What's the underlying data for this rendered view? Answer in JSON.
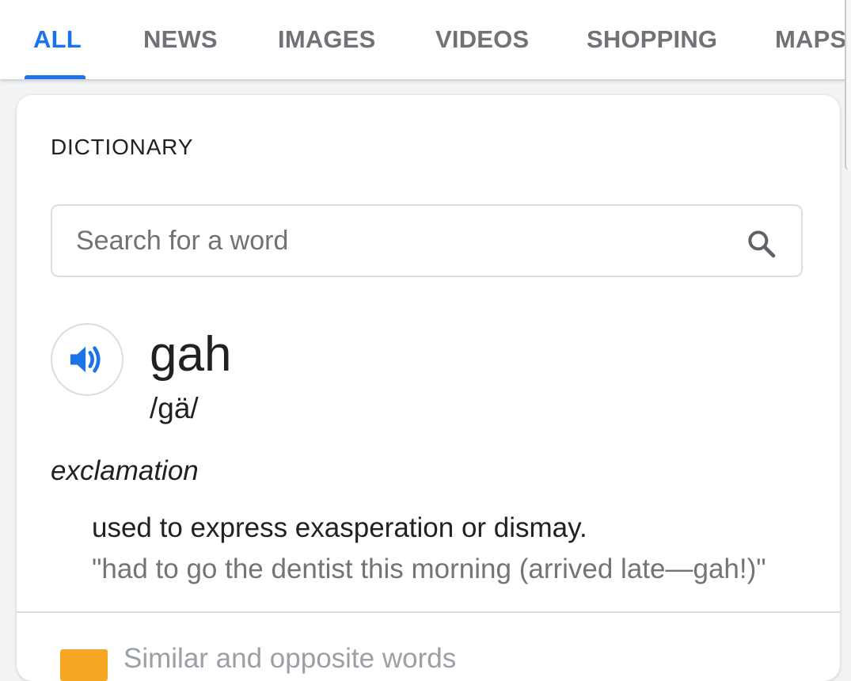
{
  "tabs": [
    {
      "label": "ALL",
      "active": true
    },
    {
      "label": "NEWS",
      "active": false
    },
    {
      "label": "IMAGES",
      "active": false
    },
    {
      "label": "VIDEOS",
      "active": false
    },
    {
      "label": "SHOPPING",
      "active": false
    },
    {
      "label": "MAPS",
      "active": false
    }
  ],
  "dictionary": {
    "title": "DICTIONARY",
    "search": {
      "placeholder": "Search for a word",
      "value": "",
      "icon": "search-icon"
    },
    "entry": {
      "pronounce_icon": "speaker-icon",
      "word": "gah",
      "phonetic": "/gä/",
      "part_of_speech": "exclamation",
      "definition": "used to express exasperation or dismay.",
      "example": "\"had to go the dentist this morning (arrived late—gah!)\""
    },
    "footer": {
      "text": "Similar and opposite words"
    }
  },
  "colors": {
    "accent": "#1a73e8",
    "tab_inactive": "#6f7377",
    "text": "#202124",
    "example_text": "#70757a",
    "badge": "#f5a623"
  }
}
